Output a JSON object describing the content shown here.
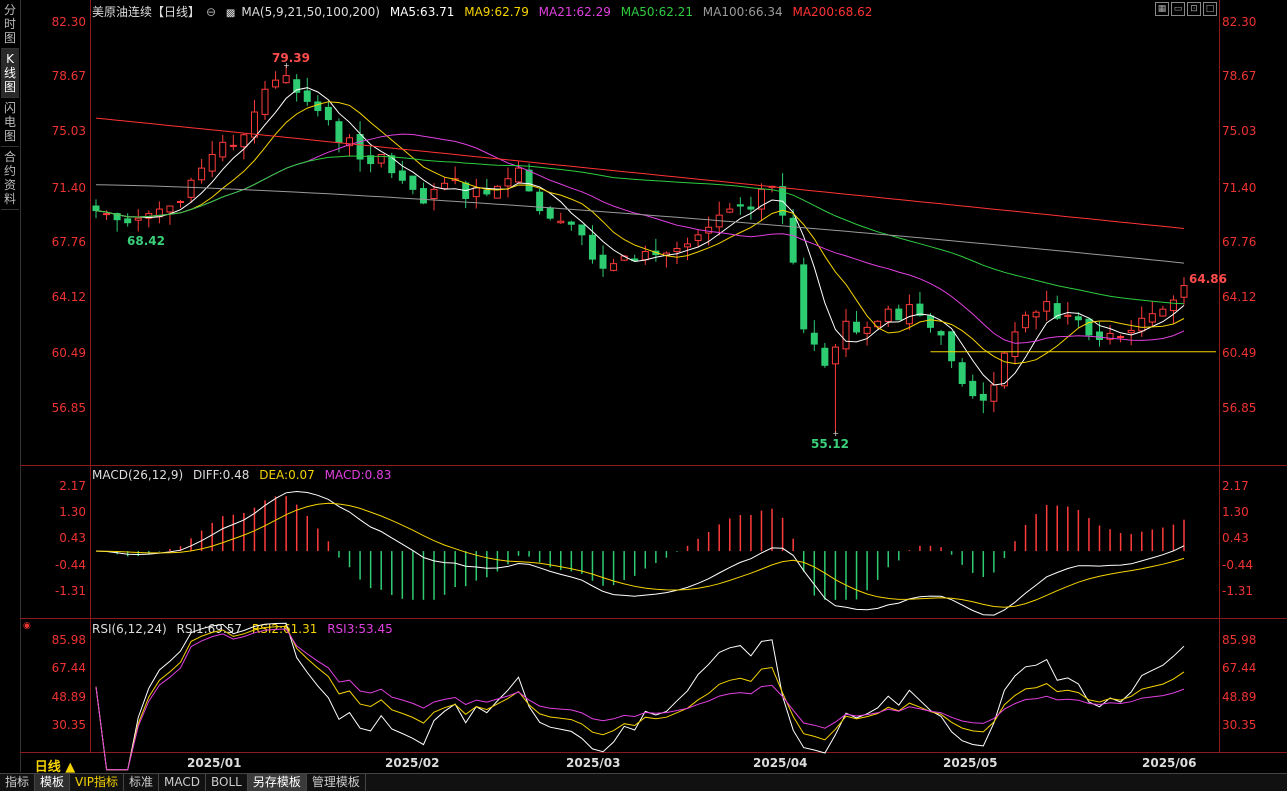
{
  "side_tabs": [
    "分时图",
    "K线图",
    "闪电图",
    "合约资料"
  ],
  "main_legend": {
    "title": "美原油连续【日线】",
    "ma_periods": "MA(5,9,21,50,100,200)",
    "ma5": "MA5:63.71",
    "ma9": "MA9:62.79",
    "ma21": "MA21:62.29",
    "ma50": "MA50:62.21",
    "ma100": "MA100:66.34",
    "ma200": "MA200:68.62"
  },
  "price_axis": [
    "82.30",
    "78.67",
    "75.03",
    "71.40",
    "67.76",
    "64.12",
    "60.49",
    "56.85"
  ],
  "annotations": {
    "high": "79.39",
    "low1": "68.42",
    "low2": "55.12",
    "last": "64.86"
  },
  "macd_legend": {
    "title": "MACD(26,12,9)",
    "diff": "DIFF:0.48",
    "dea": "DEA:0.07",
    "macd": "MACD:0.83"
  },
  "macd_axis": [
    "2.17",
    "1.30",
    "0.43",
    "-0.44",
    "-1.31"
  ],
  "rsi_legend": {
    "title": "RSI(6,12,24)",
    "rsi1": "RSI1:69.57",
    "rsi2": "RSI2:61.31",
    "rsi3": "RSI3:53.45"
  },
  "rsi_axis": [
    "85.98",
    "67.44",
    "48.89",
    "30.35"
  ],
  "date_axis": [
    "2025/01",
    "2025/02",
    "2025/03",
    "2025/04",
    "2025/05",
    "2025/06"
  ],
  "period_label": "日线 ▲",
  "bottom_tabs": [
    "指标",
    "模板",
    "VIP指标",
    "标准",
    "MACD",
    "BOLL",
    "另存模板",
    "管理模板"
  ],
  "colors": {
    "up": "#ff3b3b",
    "down": "#2ecc71",
    "ma5": "#ffffff",
    "ma9": "#f5d300",
    "ma21": "#e040e0",
    "ma50": "#2ecc40",
    "ma100": "#9a9a9a",
    "ma200": "#ff3333"
  },
  "chart_data": {
    "type": "candlestick",
    "x": [
      "2025/01",
      "2025/02",
      "2025/03",
      "2025/04",
      "2025/05",
      "2025/06"
    ],
    "ylim": [
      55.12,
      82.3
    ],
    "key_points": {
      "high": 79.39,
      "low_jan": 68.42,
      "low_apr": 55.12,
      "last": 64.86
    },
    "close": [
      69.8,
      69.6,
      69.2,
      69.0,
      69.3,
      69.6,
      69.9,
      70.1,
      70.4,
      71.8,
      72.6,
      73.5,
      74.3,
      74.1,
      74.8,
      76.3,
      77.8,
      78.4,
      78.7,
      77.6,
      77.0,
      76.4,
      75.8,
      74.3,
      74.6,
      73.2,
      72.9,
      73.5,
      72.3,
      71.8,
      71.2,
      70.3,
      71.2,
      71.6,
      71.9,
      70.6,
      71.3,
      70.9,
      71.4,
      71.9,
      72.6,
      71.1,
      69.8,
      69.3,
      69.1,
      68.9,
      68.2,
      66.6,
      66.0,
      66.3,
      66.8,
      66.5,
      67.1,
      66.9,
      67.0,
      67.3,
      67.6,
      68.2,
      68.7,
      69.5,
      69.9,
      70.1,
      69.9,
      71.2,
      71.4,
      69.5,
      66.4,
      62.0,
      61.0,
      59.6,
      60.8,
      62.5,
      61.8,
      62.1,
      62.5,
      63.3,
      62.6,
      63.6,
      62.9,
      62.1,
      61.6,
      59.9,
      58.4,
      57.6,
      57.3,
      58.3,
      60.4,
      61.8,
      62.9,
      63.1,
      63.8,
      62.7,
      62.9,
      62.6,
      61.6,
      61.3,
      61.7,
      61.5,
      61.9,
      62.7,
      63.0,
      63.3,
      63.9,
      64.86
    ],
    "macd": {
      "diff_last": 0.48,
      "dea_last": 0.07,
      "macd_last": 0.83
    },
    "rsi": {
      "rsi1_last": 69.57,
      "rsi2_last": 61.31,
      "rsi3_last": 53.45
    }
  }
}
